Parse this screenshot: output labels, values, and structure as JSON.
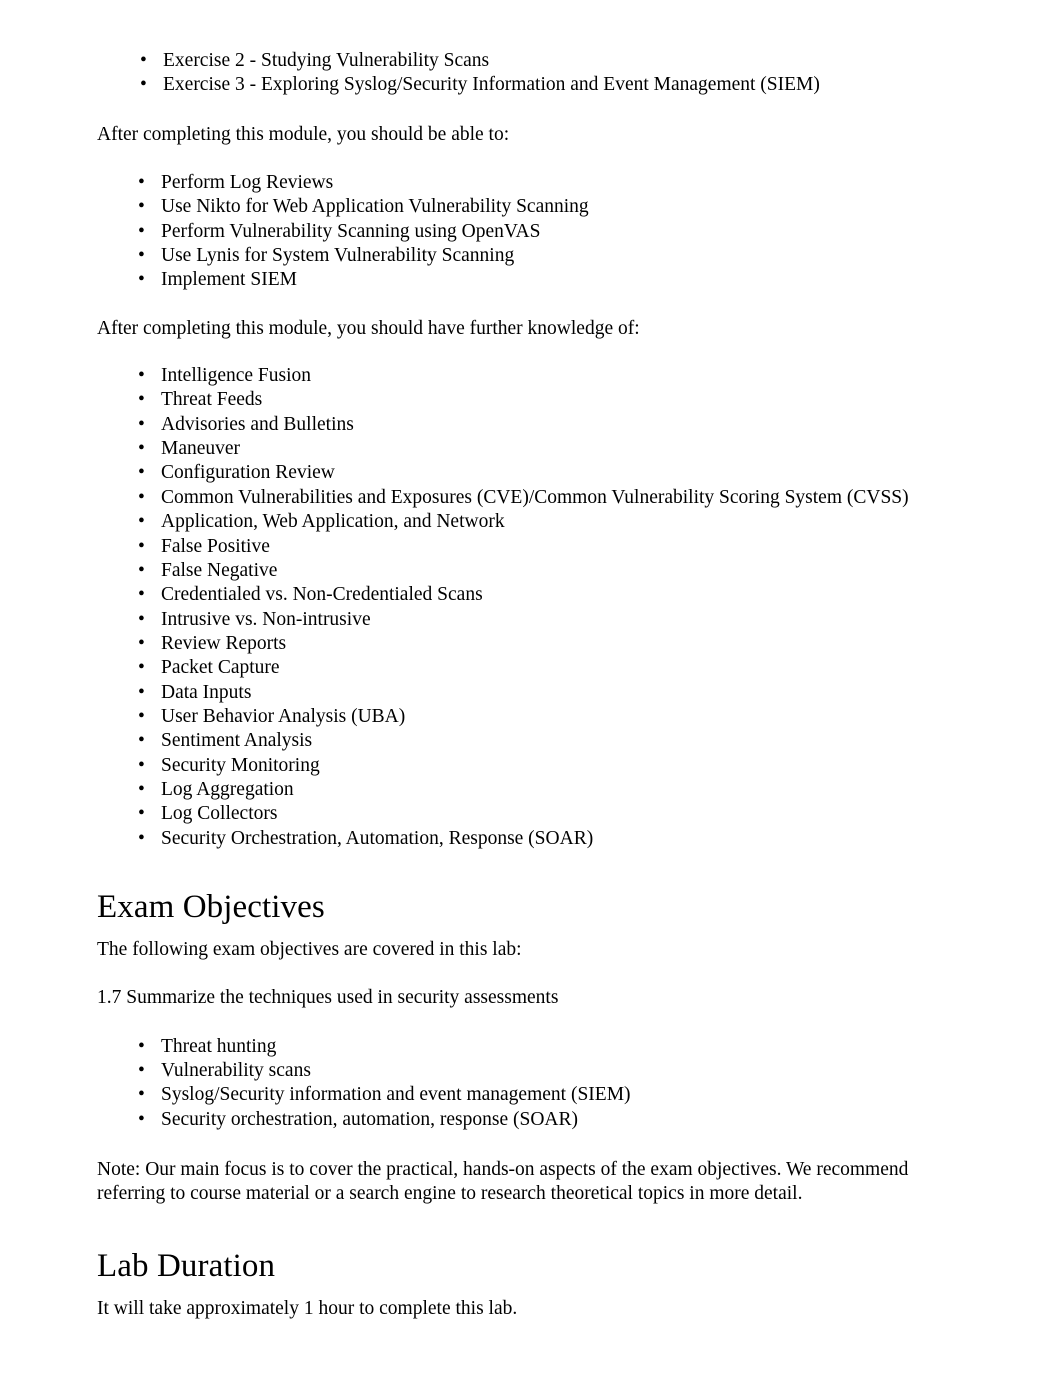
{
  "document": {
    "exercise_list": [
      "Exercise 2 - Studying Vulnerability Scans",
      "Exercise 3 - Exploring Syslog/Security Information and Event Management (SIEM)"
    ],
    "intro_able": "After completing this module, you should be able to:",
    "objectives_able": [
      "Perform Log Reviews",
      "Use Nikto for Web Application Vulnerability Scanning",
      "Perform Vulnerability Scanning using OpenVAS",
      "Use Lynis for System Vulnerability Scanning",
      "Implement SIEM"
    ],
    "intro_knowledge": "After completing this module, you should have further knowledge of:",
    "knowledge_topics": [
      "Intelligence Fusion",
      "Threat Feeds",
      "Advisories and Bulletins",
      "Maneuver",
      "Configuration Review",
      "Common Vulnerabilities and Exposures (CVE)/Common Vulnerability Scoring System (CVSS)",
      "Application, Web Application, and Network",
      "False Positive",
      "False Negative",
      "Credentialed vs. Non-Credentialed Scans",
      "Intrusive vs. Non-intrusive",
      "Review Reports",
      "Packet Capture",
      "Data Inputs",
      "User Behavior Analysis (UBA)",
      "Sentiment Analysis",
      "Security Monitoring",
      "Log Aggregation",
      "Log Collectors",
      "Security Orchestration, Automation, Response (SOAR)"
    ],
    "exam_objectives": {
      "heading": "Exam Objectives",
      "intro": "The following exam objectives are covered in this lab:",
      "objective_line": "1.7 Summarize the techniques used in security assessments",
      "items": [
        "Threat hunting",
        "Vulnerability scans",
        "Syslog/Security information and event management (SIEM)",
        "Security orchestration, automation, response (SOAR)"
      ],
      "note": "Note: Our main focus is to cover the practical, hands-on aspects of the exam objectives. We recommend referring to course material or a search engine to research theoretical topics in more detail."
    },
    "lab_duration": {
      "heading": "Lab Duration",
      "text": "It will take approximately 1 hour  to complete this lab."
    },
    "bullet_glyph": "•"
  }
}
